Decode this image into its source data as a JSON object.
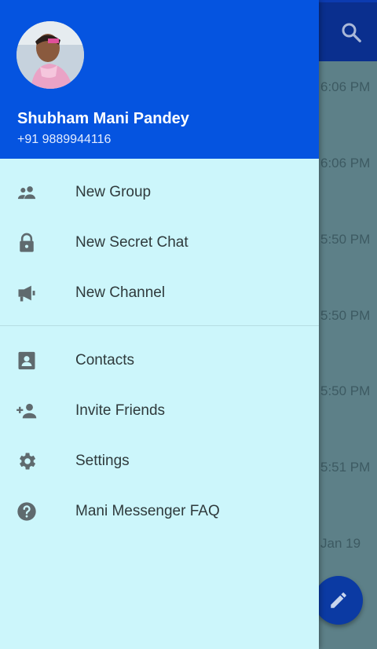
{
  "chat_list_background": {
    "times": [
      "6:06 PM",
      "6:06 PM",
      "5:50 PM",
      "5:50 PM",
      "5:50 PM",
      "5:51 PM",
      "Jan 19"
    ]
  },
  "drawer": {
    "user": {
      "name": "Shubham Mani Pandey",
      "phone": "+91 9889944116"
    },
    "menu": [
      {
        "label": "New Group",
        "icon": "group-icon"
      },
      {
        "label": "New Secret Chat",
        "icon": "lock-icon"
      },
      {
        "label": "New Channel",
        "icon": "megaphone-icon"
      },
      {
        "label": "Contacts",
        "icon": "contact-icon"
      },
      {
        "label": "Invite Friends",
        "icon": "add-person-icon"
      },
      {
        "label": "Settings",
        "icon": "gear-icon"
      },
      {
        "label": "Mani Messenger FAQ",
        "icon": "help-icon"
      }
    ]
  },
  "colors": {
    "header": "#0554e0",
    "drawer_bg": "#ccf6fb",
    "toolbar": "#0a2f8e",
    "fab": "#0b3aa3"
  }
}
